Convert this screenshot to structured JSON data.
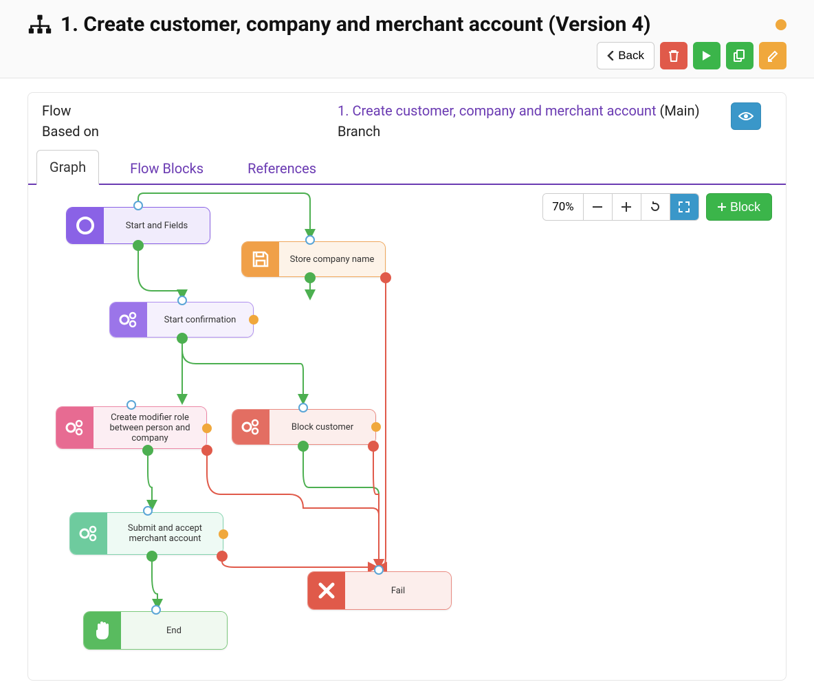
{
  "header": {
    "title": "1. Create customer, company and merchant account (Version 4)",
    "back_label": "Back",
    "status_color": "#f0a83c"
  },
  "meta": {
    "flow_label": "Flow",
    "based_on_label": "Based on",
    "branch_label": "Branch",
    "flow_value": "1. Create customer, company and merchant account",
    "flow_suffix": "(Main)"
  },
  "tabs": {
    "graph": "Graph",
    "flow_blocks": "Flow Blocks",
    "references": "References"
  },
  "toolbar": {
    "zoom": "70%",
    "add_block": "Block"
  },
  "nodes": {
    "start": "Start and Fields",
    "store_company": "Store company name",
    "start_confirm": "Start confirmation",
    "modifier_role": "Create modifier role between person and company",
    "block_customer": "Block customer",
    "submit_accept": "Submit and accept merchant account",
    "end": "End",
    "fail": "Fail"
  },
  "colors": {
    "accent_purple": "#6a3ab2",
    "green": "#3bb54a",
    "red": "#e05a4a",
    "orange": "#f0a83c",
    "blue": "#3a97c9"
  }
}
